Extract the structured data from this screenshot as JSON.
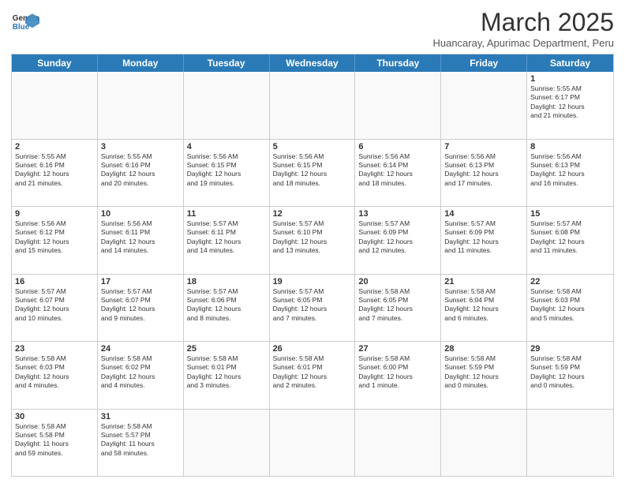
{
  "logo": {
    "text_general": "General",
    "text_blue": "Blue"
  },
  "header": {
    "month_title": "March 2025",
    "subtitle": "Huancaray, Apurimac Department, Peru"
  },
  "weekdays": [
    "Sunday",
    "Monday",
    "Tuesday",
    "Wednesday",
    "Thursday",
    "Friday",
    "Saturday"
  ],
  "rows": [
    [
      {
        "num": "",
        "info": ""
      },
      {
        "num": "",
        "info": ""
      },
      {
        "num": "",
        "info": ""
      },
      {
        "num": "",
        "info": ""
      },
      {
        "num": "",
        "info": ""
      },
      {
        "num": "",
        "info": ""
      },
      {
        "num": "1",
        "info": "Sunrise: 5:55 AM\nSunset: 6:17 PM\nDaylight: 12 hours\nand 21 minutes."
      }
    ],
    [
      {
        "num": "2",
        "info": "Sunrise: 5:55 AM\nSunset: 6:16 PM\nDaylight: 12 hours\nand 21 minutes."
      },
      {
        "num": "3",
        "info": "Sunrise: 5:55 AM\nSunset: 6:16 PM\nDaylight: 12 hours\nand 20 minutes."
      },
      {
        "num": "4",
        "info": "Sunrise: 5:56 AM\nSunset: 6:15 PM\nDaylight: 12 hours\nand 19 minutes."
      },
      {
        "num": "5",
        "info": "Sunrise: 5:56 AM\nSunset: 6:15 PM\nDaylight: 12 hours\nand 18 minutes."
      },
      {
        "num": "6",
        "info": "Sunrise: 5:56 AM\nSunset: 6:14 PM\nDaylight: 12 hours\nand 18 minutes."
      },
      {
        "num": "7",
        "info": "Sunrise: 5:56 AM\nSunset: 6:13 PM\nDaylight: 12 hours\nand 17 minutes."
      },
      {
        "num": "8",
        "info": "Sunrise: 5:56 AM\nSunset: 6:13 PM\nDaylight: 12 hours\nand 16 minutes."
      }
    ],
    [
      {
        "num": "9",
        "info": "Sunrise: 5:56 AM\nSunset: 6:12 PM\nDaylight: 12 hours\nand 15 minutes."
      },
      {
        "num": "10",
        "info": "Sunrise: 5:56 AM\nSunset: 6:11 PM\nDaylight: 12 hours\nand 14 minutes."
      },
      {
        "num": "11",
        "info": "Sunrise: 5:57 AM\nSunset: 6:11 PM\nDaylight: 12 hours\nand 14 minutes."
      },
      {
        "num": "12",
        "info": "Sunrise: 5:57 AM\nSunset: 6:10 PM\nDaylight: 12 hours\nand 13 minutes."
      },
      {
        "num": "13",
        "info": "Sunrise: 5:57 AM\nSunset: 6:09 PM\nDaylight: 12 hours\nand 12 minutes."
      },
      {
        "num": "14",
        "info": "Sunrise: 5:57 AM\nSunset: 6:09 PM\nDaylight: 12 hours\nand 11 minutes."
      },
      {
        "num": "15",
        "info": "Sunrise: 5:57 AM\nSunset: 6:08 PM\nDaylight: 12 hours\nand 11 minutes."
      }
    ],
    [
      {
        "num": "16",
        "info": "Sunrise: 5:57 AM\nSunset: 6:07 PM\nDaylight: 12 hours\nand 10 minutes."
      },
      {
        "num": "17",
        "info": "Sunrise: 5:57 AM\nSunset: 6:07 PM\nDaylight: 12 hours\nand 9 minutes."
      },
      {
        "num": "18",
        "info": "Sunrise: 5:57 AM\nSunset: 6:06 PM\nDaylight: 12 hours\nand 8 minutes."
      },
      {
        "num": "19",
        "info": "Sunrise: 5:57 AM\nSunset: 6:05 PM\nDaylight: 12 hours\nand 7 minutes."
      },
      {
        "num": "20",
        "info": "Sunrise: 5:58 AM\nSunset: 6:05 PM\nDaylight: 12 hours\nand 7 minutes."
      },
      {
        "num": "21",
        "info": "Sunrise: 5:58 AM\nSunset: 6:04 PM\nDaylight: 12 hours\nand 6 minutes."
      },
      {
        "num": "22",
        "info": "Sunrise: 5:58 AM\nSunset: 6:03 PM\nDaylight: 12 hours\nand 5 minutes."
      }
    ],
    [
      {
        "num": "23",
        "info": "Sunrise: 5:58 AM\nSunset: 6:03 PM\nDaylight: 12 hours\nand 4 minutes."
      },
      {
        "num": "24",
        "info": "Sunrise: 5:58 AM\nSunset: 6:02 PM\nDaylight: 12 hours\nand 4 minutes."
      },
      {
        "num": "25",
        "info": "Sunrise: 5:58 AM\nSunset: 6:01 PM\nDaylight: 12 hours\nand 3 minutes."
      },
      {
        "num": "26",
        "info": "Sunrise: 5:58 AM\nSunset: 6:01 PM\nDaylight: 12 hours\nand 2 minutes."
      },
      {
        "num": "27",
        "info": "Sunrise: 5:58 AM\nSunset: 6:00 PM\nDaylight: 12 hours\nand 1 minute."
      },
      {
        "num": "28",
        "info": "Sunrise: 5:58 AM\nSunset: 5:59 PM\nDaylight: 12 hours\nand 0 minutes."
      },
      {
        "num": "29",
        "info": "Sunrise: 5:58 AM\nSunset: 5:59 PM\nDaylight: 12 hours\nand 0 minutes."
      }
    ],
    [
      {
        "num": "30",
        "info": "Sunrise: 5:58 AM\nSunset: 5:58 PM\nDaylight: 11 hours\nand 59 minutes."
      },
      {
        "num": "31",
        "info": "Sunrise: 5:58 AM\nSunset: 5:57 PM\nDaylight: 11 hours\nand 58 minutes."
      },
      {
        "num": "",
        "info": ""
      },
      {
        "num": "",
        "info": ""
      },
      {
        "num": "",
        "info": ""
      },
      {
        "num": "",
        "info": ""
      },
      {
        "num": "",
        "info": ""
      }
    ]
  ]
}
